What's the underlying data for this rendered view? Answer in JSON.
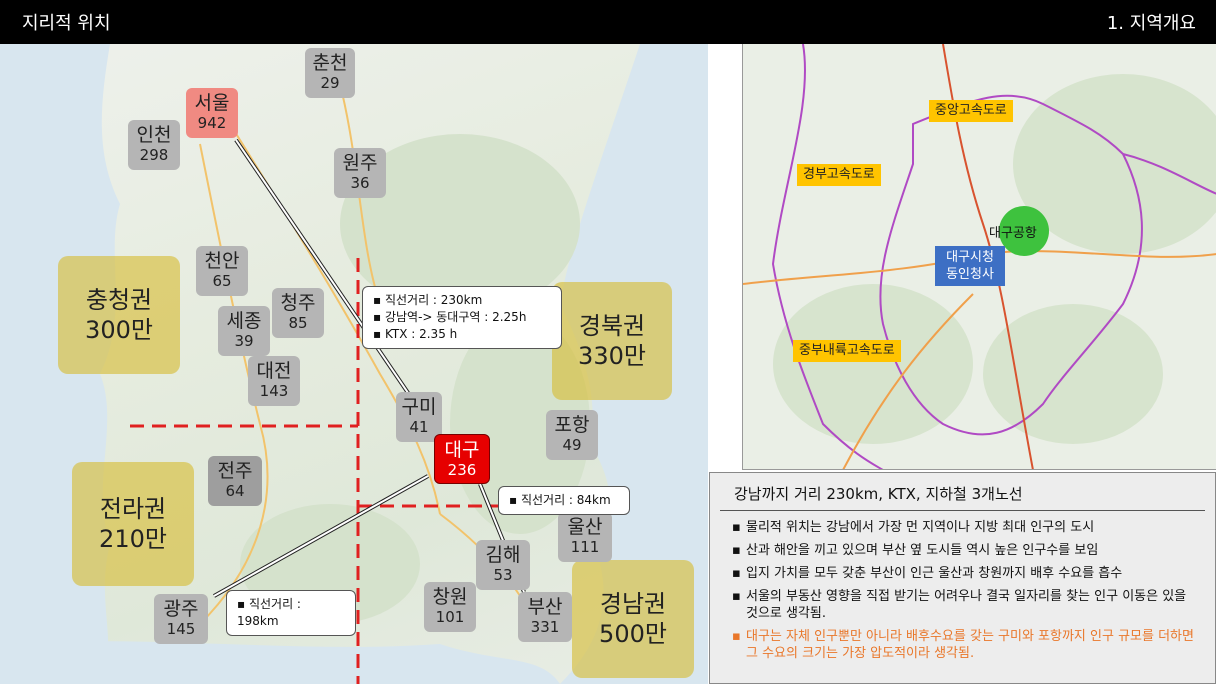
{
  "header": {
    "title": "지리적 위치",
    "section": "1. 지역개요"
  },
  "cities": {
    "seoul": {
      "name": "서울",
      "count": "942"
    },
    "incheon": {
      "name": "인천",
      "count": "298"
    },
    "chuncheon": {
      "name": "춘천",
      "count": "29"
    },
    "wonju": {
      "name": "원주",
      "count": "36"
    },
    "cheonan": {
      "name": "천안",
      "count": "65"
    },
    "cheongju": {
      "name": "청주",
      "count": "85"
    },
    "sejong": {
      "name": "세종",
      "count": "39"
    },
    "daejeon": {
      "name": "대전",
      "count": "143"
    },
    "gumi": {
      "name": "구미",
      "count": "41"
    },
    "daegu": {
      "name": "대구",
      "count": "236"
    },
    "pohang": {
      "name": "포항",
      "count": "49"
    },
    "jeonju": {
      "name": "전주",
      "count": "64"
    },
    "ulsan": {
      "name": "울산",
      "count": "111"
    },
    "gimhae": {
      "name": "김해",
      "count": "53"
    },
    "changwon": {
      "name": "창원",
      "count": "101"
    },
    "busan": {
      "name": "부산",
      "count": "331"
    },
    "gwangju": {
      "name": "광주",
      "count": "145"
    }
  },
  "regions": {
    "chungcheong": {
      "name": "충청권",
      "pop": "300만"
    },
    "gyeongbuk": {
      "name": "경북권",
      "pop": "330만"
    },
    "jeolla": {
      "name": "전라권",
      "pop": "210만"
    },
    "gyeongnam": {
      "name": "경남권",
      "pop": "500만"
    }
  },
  "callouts": {
    "seoul": [
      "▪ 직선거리 : 230km",
      "▪ 강남역-> 동대구역 : 2.25h",
      "▪ KTX : 2.35 h"
    ],
    "busan": "▪ 직선거리 : 84km",
    "gwangju": "▪ 직선거리 : 198km"
  },
  "right_map": {
    "roads": {
      "jungang": "중앙고속도로",
      "gyeongbu": "경부고속도로",
      "jungbu_naeryuk": "중부내륙고속도로"
    },
    "cityhall": [
      "대구시청",
      "동인청사"
    ],
    "airport": "대구공항"
  },
  "info": {
    "title": "강남까지 거리 230km, KTX, 지하철 3개노선",
    "bullets": [
      "물리적 위치는 강남에서 가장 먼 지역이나 지방 최대 인구의 도시",
      "산과 해안을 끼고 있으며 부산 옆 도시들 역시 높은 인구수를 보임",
      "입지 가치를 모두 갖춘 부산이 인근 울산과 창원까지 배후 수요를 흡수",
      "서울의 부동산 영향을 직접 받기는 어려우나 결국 일자리를 찾는 인구 이동은 있을 것으로 생각됨.",
      "대구는 자체 인구뿐만 아니라 배후수요를 갖는 구미와 포항까지 인구 규모를 더하면 그 수요의 크기는 가장 압도적이라 생각됨."
    ]
  },
  "colors": {
    "seoul": "#f08a82",
    "daegu": "#e60000",
    "region": "#d7be3c",
    "road": "#ffc400",
    "cityhall": "#3d6fc4",
    "airport": "#3ec23e"
  }
}
